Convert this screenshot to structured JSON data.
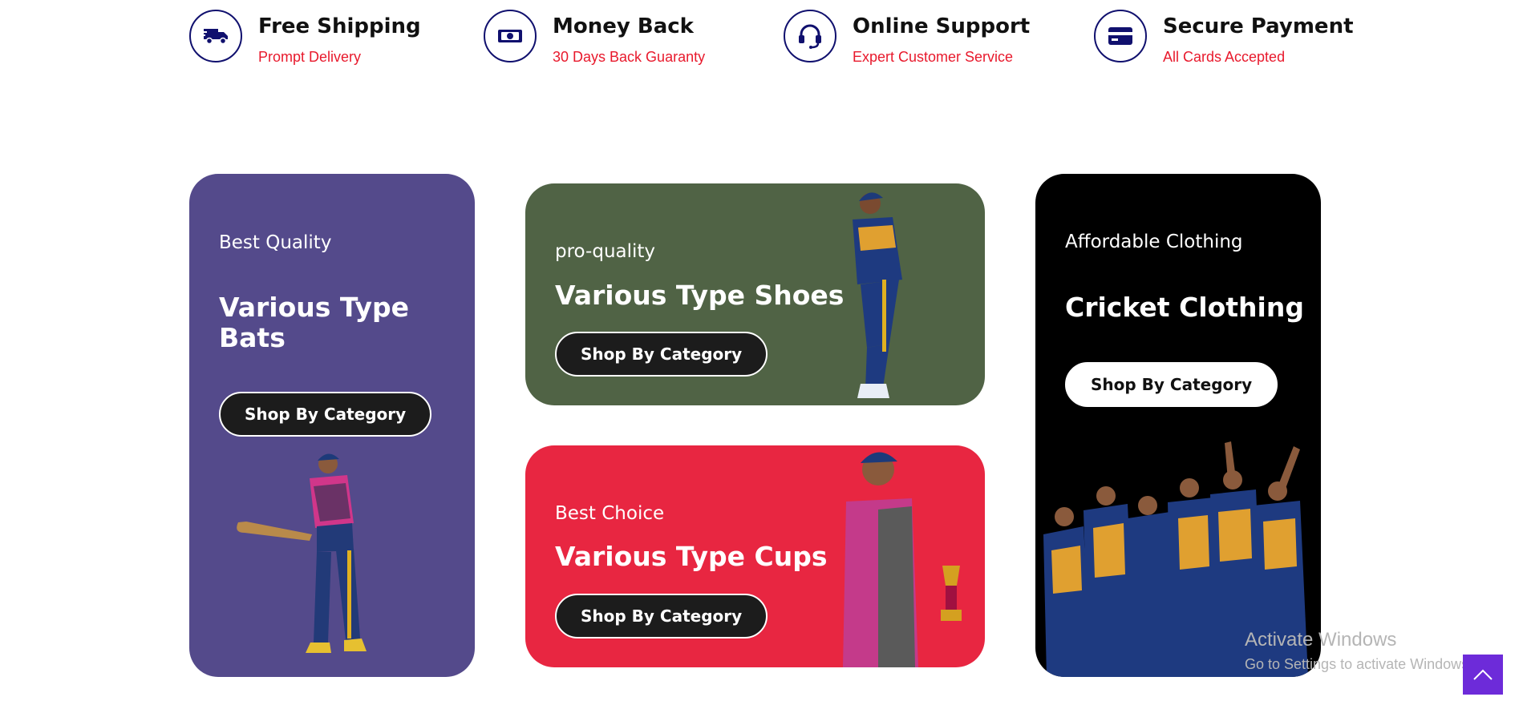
{
  "features": [
    {
      "icon": "truck-icon",
      "title": "Free Shipping",
      "subtitle": "Prompt Delivery"
    },
    {
      "icon": "money-icon",
      "title": "Money Back",
      "subtitle": "30 Days Back Guaranty"
    },
    {
      "icon": "headset-icon",
      "title": "Online Support",
      "subtitle": "Expert Customer Service"
    },
    {
      "icon": "credit-card-icon",
      "title": "Secure Payment",
      "subtitle": "All Cards Accepted"
    }
  ],
  "cards": {
    "bats": {
      "kicker": "Best Quality",
      "title_line1": "Various Type",
      "title_line2": "Bats",
      "button": "Shop By Category",
      "bg": "#544a8b"
    },
    "shoes": {
      "kicker": "pro-quality",
      "title": "Various Type Shoes",
      "button": "Shop By Category",
      "bg": "#506345"
    },
    "cups": {
      "kicker": "Best Choice",
      "title": "Various Type Cups",
      "button": "Shop By Category",
      "bg": "#e82641"
    },
    "clothing": {
      "kicker": "Affordable Clothing",
      "title": "Cricket Clothing",
      "button": "Shop By Category",
      "bg": "#000000"
    }
  },
  "watermark": {
    "line1": "Activate Windows",
    "line2": "Go to Settings to activate Windows."
  },
  "colors": {
    "navy": "#10106e",
    "red_accent": "#e8192c",
    "scroll_top": "#6d2bd9"
  }
}
